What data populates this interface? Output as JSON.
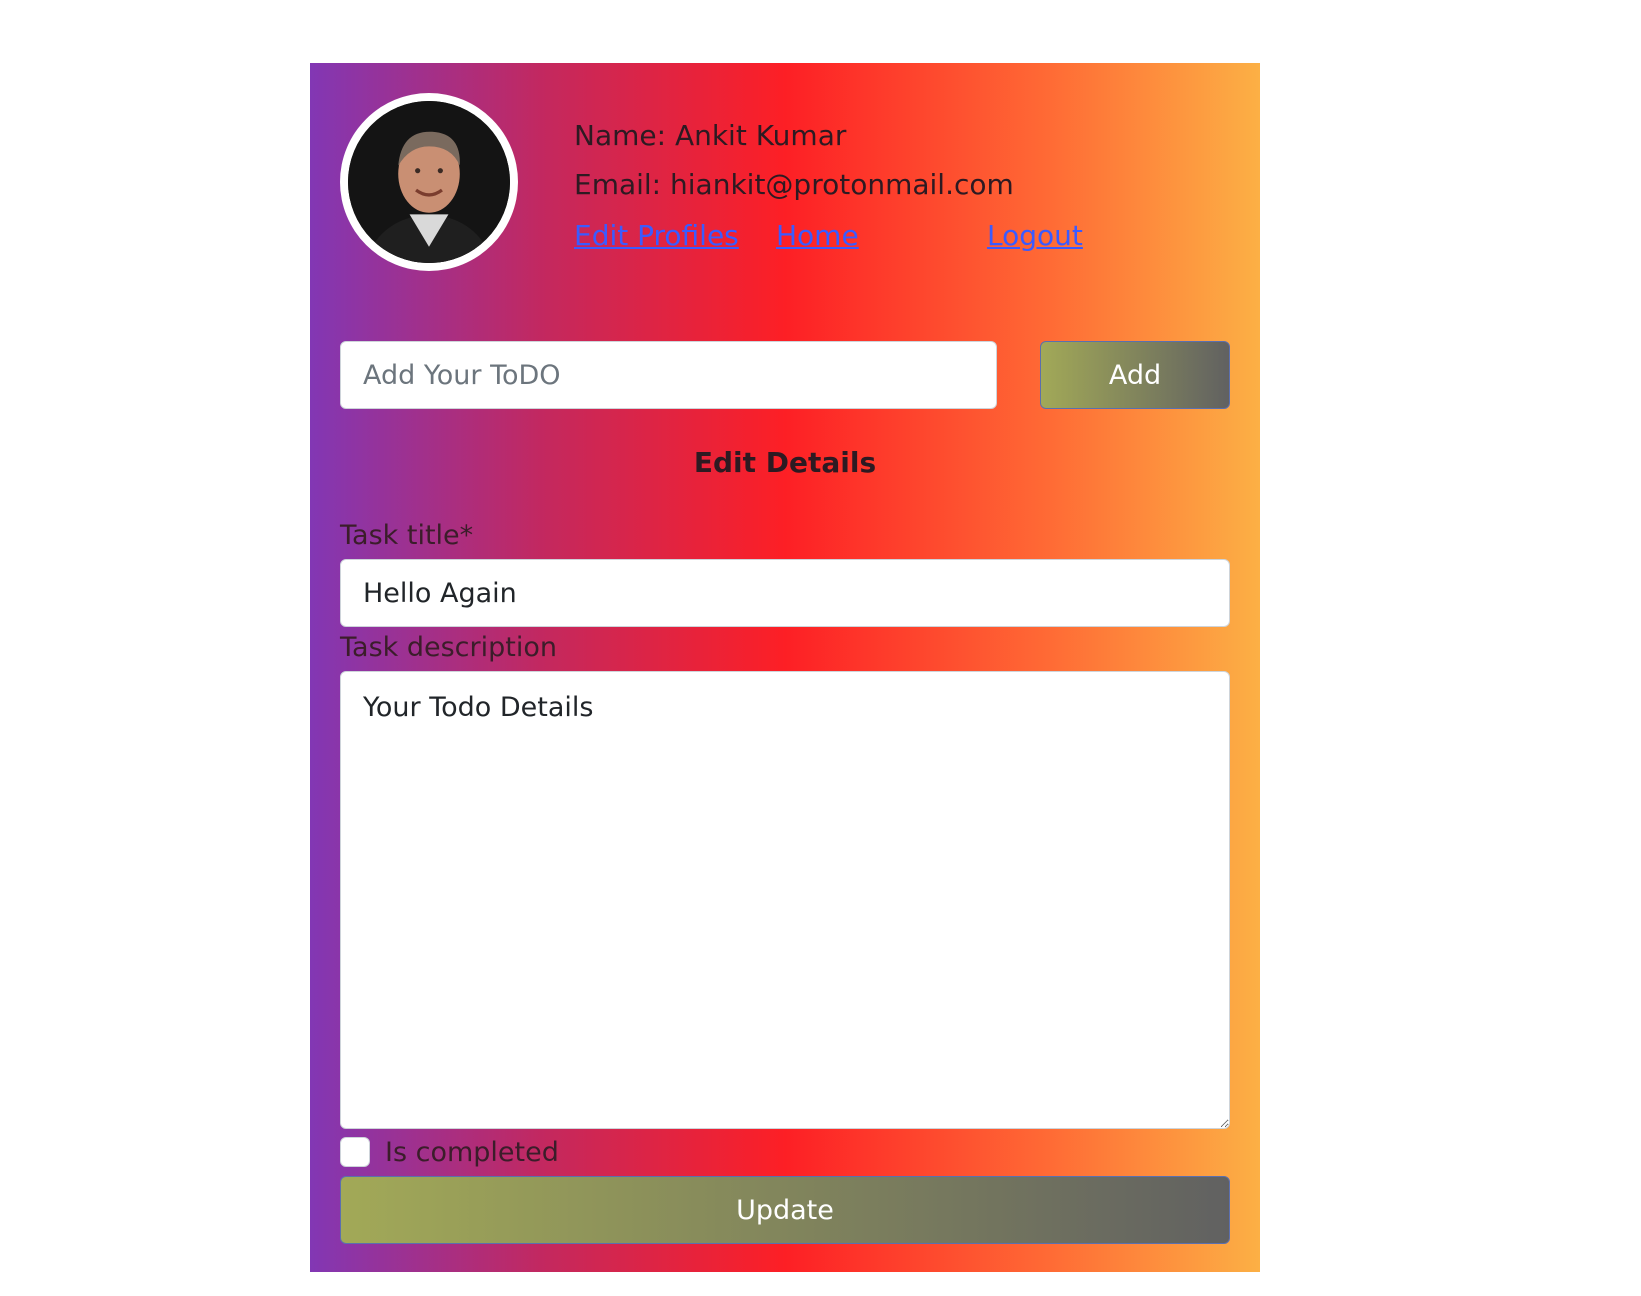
{
  "profile": {
    "name_line": "Name: Ankit Kumar",
    "email_line": "Email: hiankit@protonmail.com",
    "avatar_icon": "user-avatar-photo"
  },
  "nav": {
    "edit_profiles": "Edit Profiles",
    "home": "Home",
    "logout": "Logout"
  },
  "todo": {
    "input_placeholder": "Add Your ToDO",
    "input_value": "",
    "add_label": "Add"
  },
  "edit": {
    "section_title": "Edit Details",
    "title_label": "Task title*",
    "title_value": "Hello Again",
    "desc_label": "Task description",
    "desc_value": "Your Todo Details",
    "completed_label": "Is completed",
    "completed_checked": false,
    "update_label": "Update"
  },
  "colors": {
    "gradient": [
      "#8237b4",
      "#fd1f25",
      "#fcb045"
    ],
    "button_gradient": [
      "#a2a957",
      "#616161"
    ],
    "link": "#3a5bff"
  }
}
